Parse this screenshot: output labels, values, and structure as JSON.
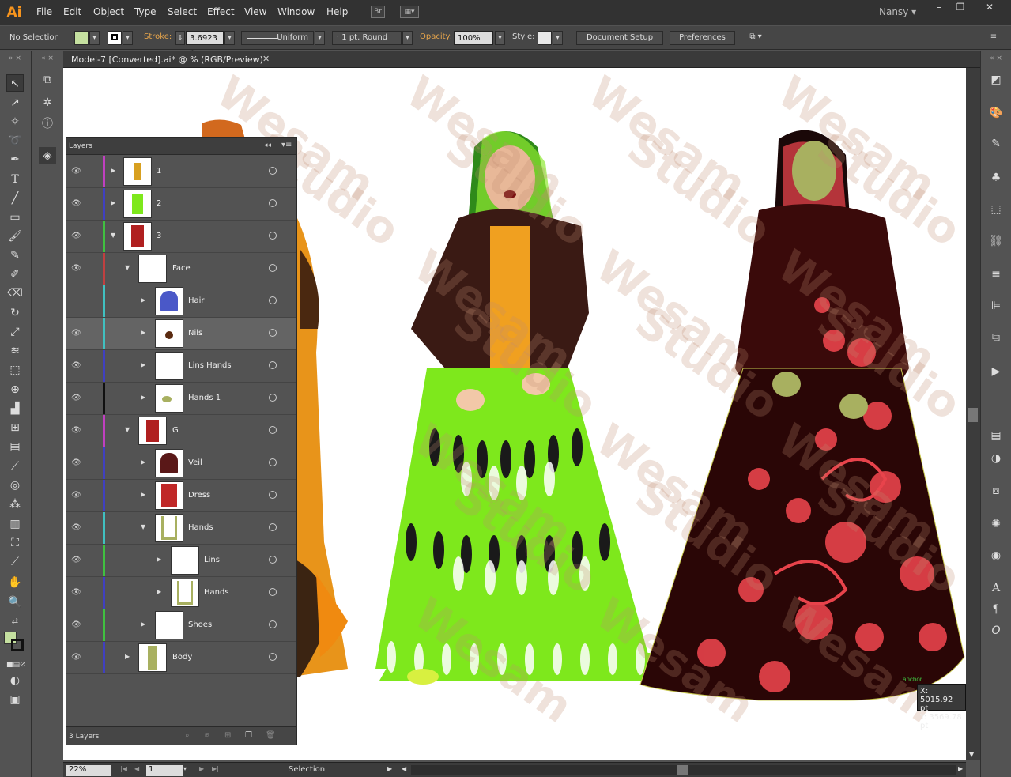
{
  "app": {
    "logo": "Ai",
    "user": "Nansy"
  },
  "menu": [
    "File",
    "Edit",
    "Object",
    "Type",
    "Select",
    "Effect",
    "View",
    "Window",
    "Help"
  ],
  "control": {
    "selection": "No Selection",
    "stroke_label": "Stroke:",
    "stroke_value": "3.6923 p",
    "profile": "Uniform",
    "brush": "1 pt. Round",
    "opacity_label": "Opacity:",
    "opacity_value": "100%",
    "style_label": "Style:",
    "document_setup": "Document Setup",
    "preferences": "Preferences"
  },
  "document": {
    "tab_title": "Model-7 [Converted].ai* @ % (RGB/Preview)"
  },
  "layers": {
    "title": "Layers",
    "count": "3 Layers",
    "rows": [
      {
        "name": "1"
      },
      {
        "name": "2"
      },
      {
        "name": "3"
      },
      {
        "name": "Face"
      },
      {
        "name": "Hair"
      },
      {
        "name": "Nils"
      },
      {
        "name": "Lins Hands"
      },
      {
        "name": "Hands 1"
      },
      {
        "name": "G"
      },
      {
        "name": "Veil"
      },
      {
        "name": "Dress"
      },
      {
        "name": "Hands"
      },
      {
        "name": "Lins"
      },
      {
        "name": "Hands"
      },
      {
        "name": "Shoes"
      },
      {
        "name": "Body"
      }
    ]
  },
  "status": {
    "zoom": "22%",
    "page": "1",
    "tool": "Selection"
  },
  "coords": {
    "x": "X: 5015.92 pt",
    "y": "Y: 3569.78 pt"
  },
  "canvas": {
    "anchor_label": "anchor",
    "watermark": [
      "Wesam",
      "Studio"
    ]
  },
  "colors": {
    "accent": "#f7941d",
    "fill_swatch": "#c5e0a0",
    "green_dress": "#7ee81c",
    "red_dress": "#e8434b"
  }
}
